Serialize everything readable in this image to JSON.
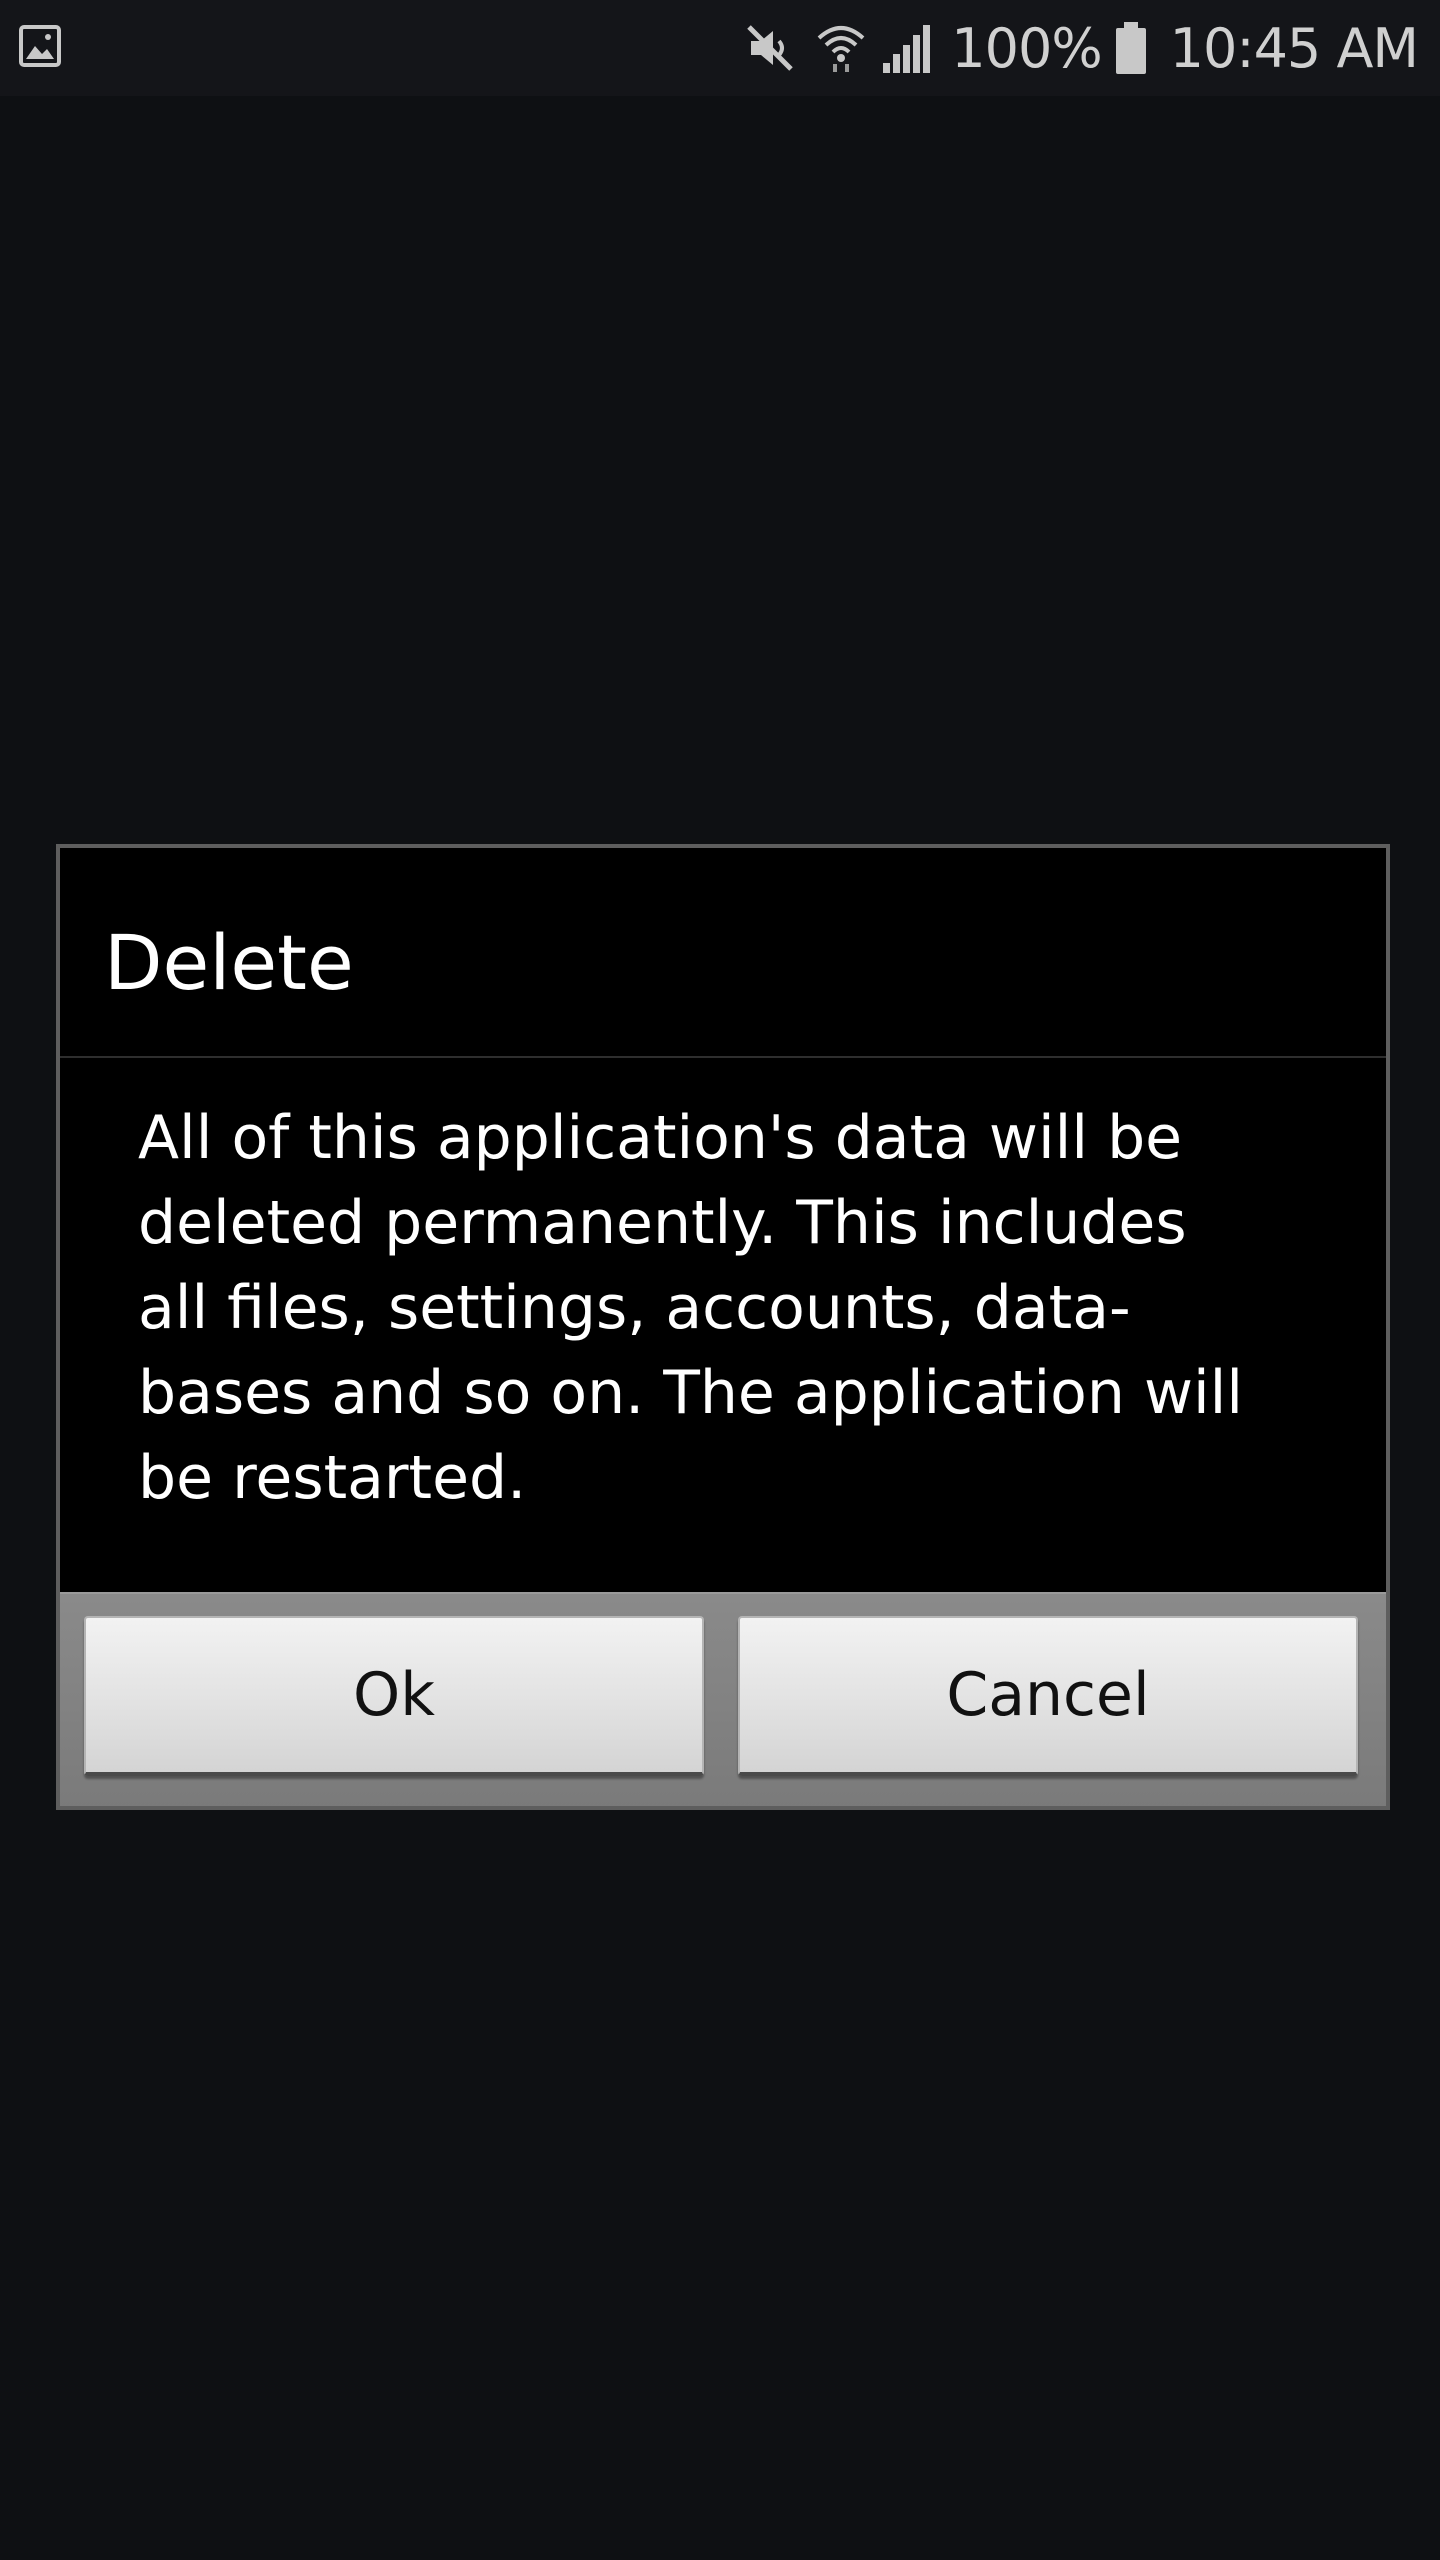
{
  "status_bar": {
    "left_icon": "image-notification-icon",
    "icons": [
      "mute-icon",
      "wifi-icon",
      "signal-icon",
      "battery-icon"
    ],
    "battery_percent": "100%",
    "time": "10:45 AM"
  },
  "dialog": {
    "title": "Delete",
    "message": "All of this application's data will be\ndeleted permanently. This includes\nall files, settings, accounts, data-\nbases and so on. The application will\nbe restarted.",
    "ok_label": "Ok",
    "cancel_label": "Cancel"
  },
  "colors": {
    "background": "#0e1013",
    "status_bar": "#141519",
    "dialog_background": "#000000",
    "button_area": "#808080",
    "button_face": "#e2e2e2",
    "text_light": "#ffffff",
    "text_dark": "#111111"
  }
}
